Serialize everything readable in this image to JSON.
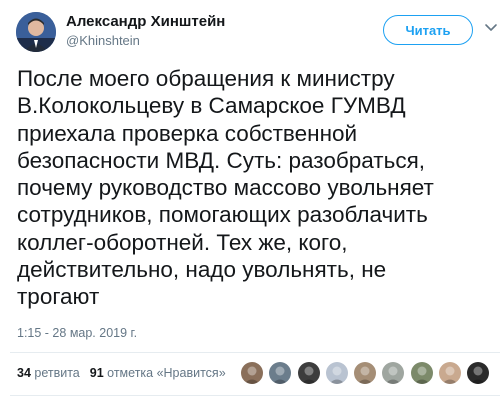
{
  "author": {
    "name": "Александр Хинштейн",
    "handle": "@Khinshtein"
  },
  "follow_label": "Читать",
  "tweet": {
    "lines": [
      "После моего обращения к министру",
      "В.Колокольцеву в Самарское ГУМВД",
      "приехала проверка собственной",
      "безопасности МВД. Суть: разобраться,",
      "почему руководство массово увольняет",
      "сотрудников, помогающих разоблачить",
      "коллег-оборотней. Тех же, кого,",
      "действительно, надо увольнять, не",
      "трогают"
    ],
    "timestamp": "1:15 - 28 мар. 2019 г."
  },
  "stats": {
    "retweets_count": "34",
    "retweets_label": "ретвита",
    "likes_count": "91",
    "likes_label": "отметка «Нравится»"
  },
  "likers": [
    {
      "icon": "liker-avatar",
      "color": "#8a6f5a"
    },
    {
      "icon": "liker-avatar",
      "color": "#6b7d8c"
    },
    {
      "icon": "liker-avatar",
      "color": "#3d3d3d"
    },
    {
      "icon": "liker-avatar",
      "color": "#b9c3d1"
    },
    {
      "icon": "liker-avatar",
      "color": "#a58e76"
    },
    {
      "icon": "liker-avatar",
      "color": "#9fa6a0"
    },
    {
      "icon": "liker-avatar",
      "color": "#7c8a6a"
    },
    {
      "icon": "liker-avatar",
      "color": "#c9a98f"
    },
    {
      "icon": "liker-avatar",
      "color": "#2a2a2a"
    }
  ],
  "colors": {
    "accent": "#1da1f2",
    "text": "#14171a",
    "secondary": "#657786",
    "divider": "#e6ecf0"
  }
}
